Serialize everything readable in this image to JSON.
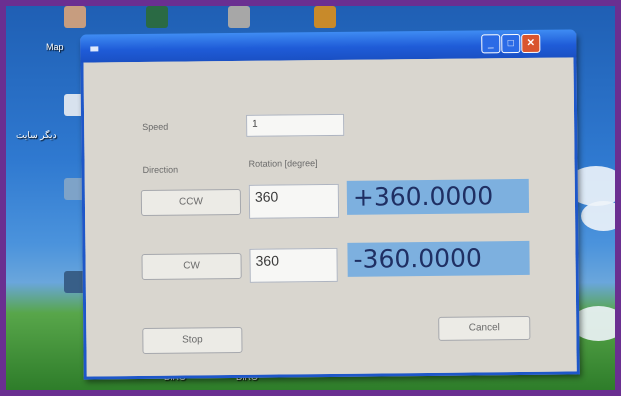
{
  "window": {
    "title": "",
    "buttons": {
      "minimize": "_",
      "maximize": "□",
      "close": "✕"
    }
  },
  "form": {
    "speed_label": "Speed",
    "speed_value": "1",
    "direction_label": "Direction",
    "rotation_label": "Rotation [degree]",
    "ccw_button": "CCW",
    "ccw_degrees": "360",
    "ccw_readout": "+360.0000",
    "cw_button": "CW",
    "cw_degrees": "360",
    "cw_readout": "-360.0000",
    "stop_button": "Stop",
    "cancel_button": "Cancel"
  },
  "desktop": {
    "left_labels": [
      "Map",
      "دیگر سایت"
    ],
    "bottom_labels": [
      "DiRO",
      "DiRO"
    ]
  },
  "colors": {
    "titlebar": "#1f5cd8",
    "readout_bg": "#7db0df",
    "readout_text": "#1f2f63",
    "frame": "#6a2f91"
  },
  "icons": [
    "minimize-icon",
    "maximize-icon",
    "close-icon",
    "window-icon"
  ]
}
